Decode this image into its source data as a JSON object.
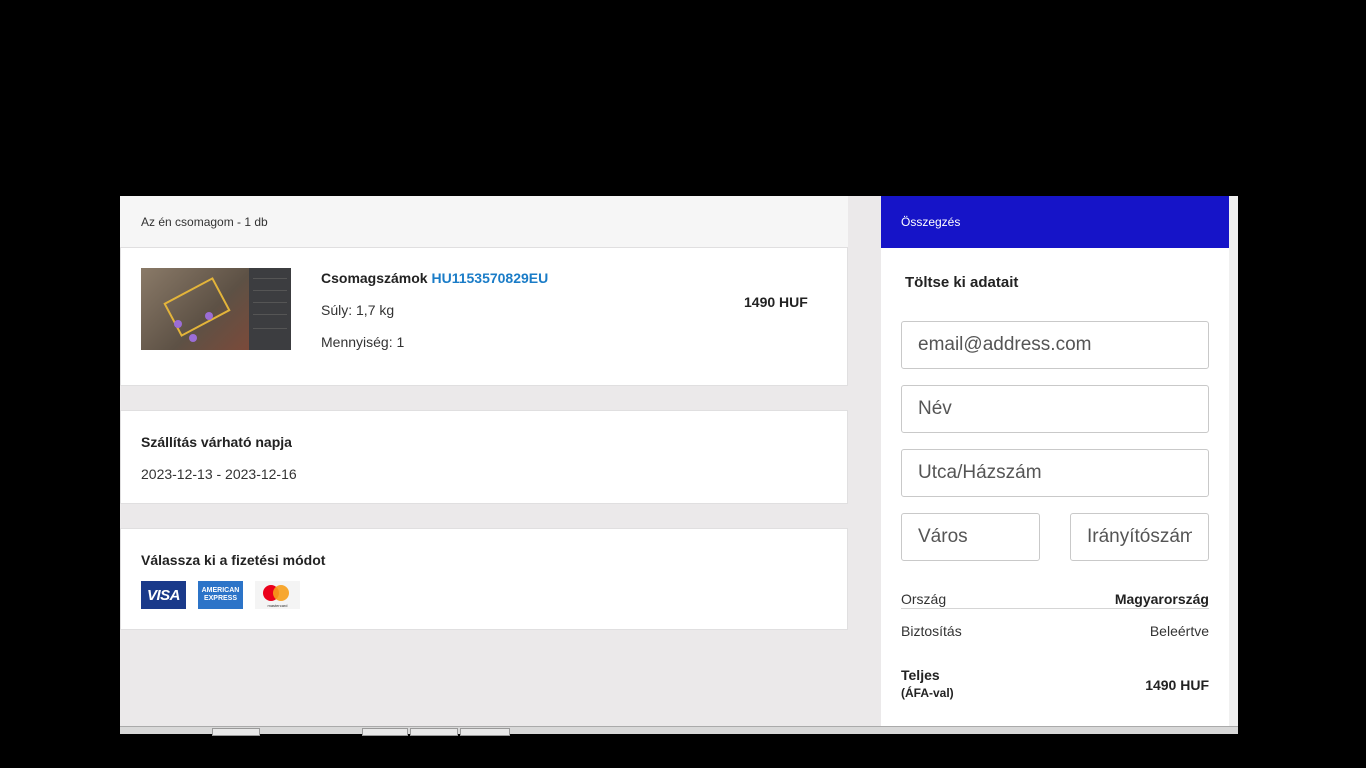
{
  "package": {
    "header": "Az én csomagom - 1 db",
    "tracking_label": "Csomagszámok",
    "tracking_number": "HU1153570829EU",
    "weight": "Súly: 1,7 kg",
    "quantity": "Mennyiség: 1",
    "price": "1490 HUF"
  },
  "shipping": {
    "title": "Szállítás várható napja",
    "dates": "2023-12-13 - 2023-12-16"
  },
  "payment": {
    "title": "Válassza ki a fizetési módot",
    "methods": [
      {
        "name": "VISA",
        "icon": "visa-logo"
      },
      {
        "name": "AMERICAN EXPRESS",
        "icon": "amex-logo"
      },
      {
        "name": "mastercard",
        "icon": "mastercard-logo"
      }
    ]
  },
  "summary": {
    "header": "Összegzés",
    "form_title": "Töltse ki adatait",
    "fields": {
      "email_placeholder": "email@address.com",
      "name_placeholder": "Név",
      "street_placeholder": "Utca/Házszám",
      "city_placeholder": "Város",
      "zip_placeholder": "Irányítószám"
    },
    "country_label": "Ország",
    "country_value": "Magyarország",
    "insurance_label": "Biztosítás",
    "insurance_value": "Beleértve",
    "total_label": "Teljes",
    "total_sub": "(ÁFA-val)",
    "total_value": "1490 HUF"
  },
  "colors": {
    "accent_header": "#1614c8",
    "tracking_link": "#1a7cc7"
  }
}
